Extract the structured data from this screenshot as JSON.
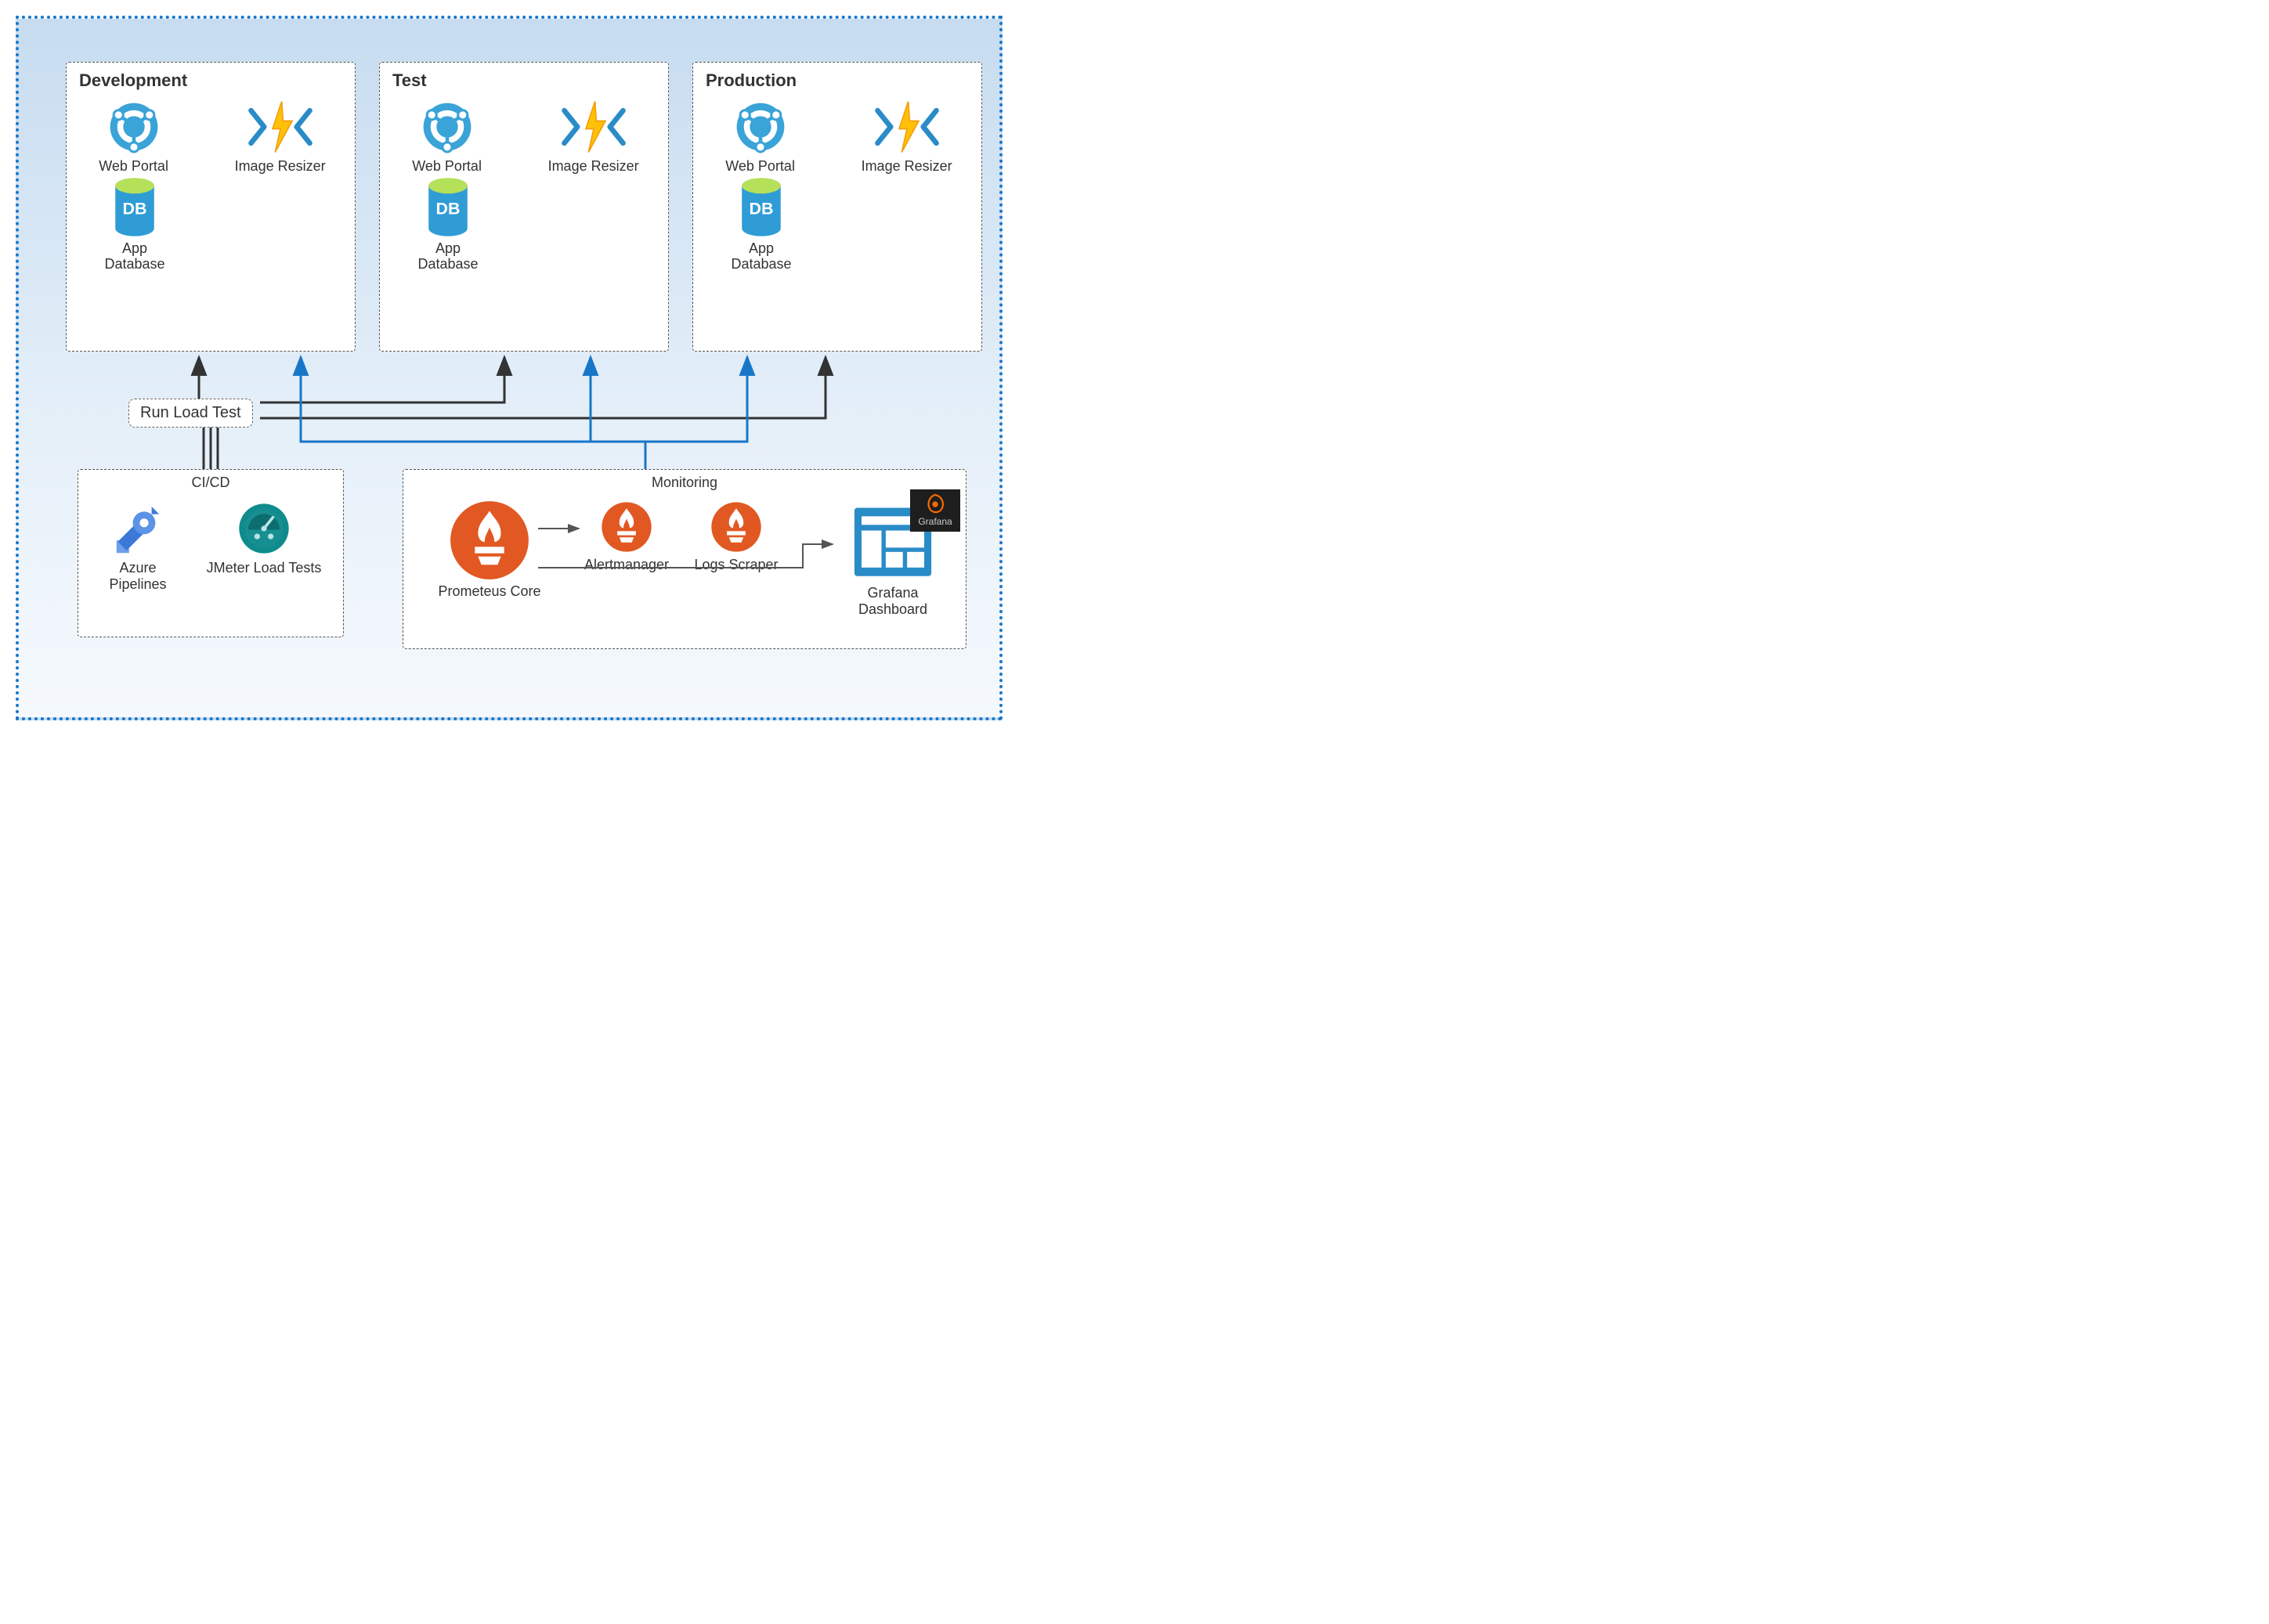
{
  "environments": [
    {
      "title": "Development",
      "webportal": "Web Portal",
      "resizer": "Image Resizer",
      "db": "App\nDatabase"
    },
    {
      "title": "Test",
      "webportal": "Web Portal",
      "resizer": "Image Resizer",
      "db": "App\nDatabase"
    },
    {
      "title": "Production",
      "webportal": "Web Portal",
      "resizer": "Image Resizer",
      "db": "App\nDatabase"
    }
  ],
  "run_load_test": "Run Load Test",
  "cicd": {
    "title": "CI/CD",
    "azure": "Azure\nPipelines",
    "jmeter": "JMeter Load Tests"
  },
  "monitoring": {
    "title": "Monitoring",
    "prometheus": "Prometeus Core",
    "alertmanager": "Alertmanager",
    "logs": "Logs Scraper",
    "grafana": "Grafana\nDashboard",
    "grafana_tag": "Grafana"
  }
}
